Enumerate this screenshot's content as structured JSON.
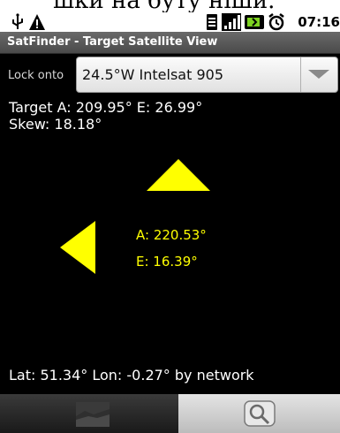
{
  "top_partial_text": "шки на буту ніши.",
  "status_bar": {
    "time": "07:16",
    "icons": [
      "usb-icon",
      "warning-icon",
      "sim-icon",
      "signal-icon",
      "battery-icon",
      "alarm-icon"
    ]
  },
  "app": {
    "title": "SatFinder - Target Satellite View"
  },
  "lock": {
    "label": "Lock onto",
    "selected": "24.5°W Intelsat 905"
  },
  "target": {
    "line1": "Target  A: 209.95°  E: 26.99°",
    "skew": "Skew: 18.18°"
  },
  "current": {
    "azimuth": "A: 220.53°",
    "elevation": "E: 16.39°"
  },
  "footer": {
    "location": "Lat: 51.34°  Lon: -0.27°  by network"
  },
  "tabs": [
    {
      "icon": "satellite-image-icon",
      "selected": false
    },
    {
      "icon": "magnifier-icon",
      "selected": true
    }
  ],
  "colors": {
    "background": "#000000",
    "indicator": "#ffff00",
    "text": "#ffffff"
  }
}
